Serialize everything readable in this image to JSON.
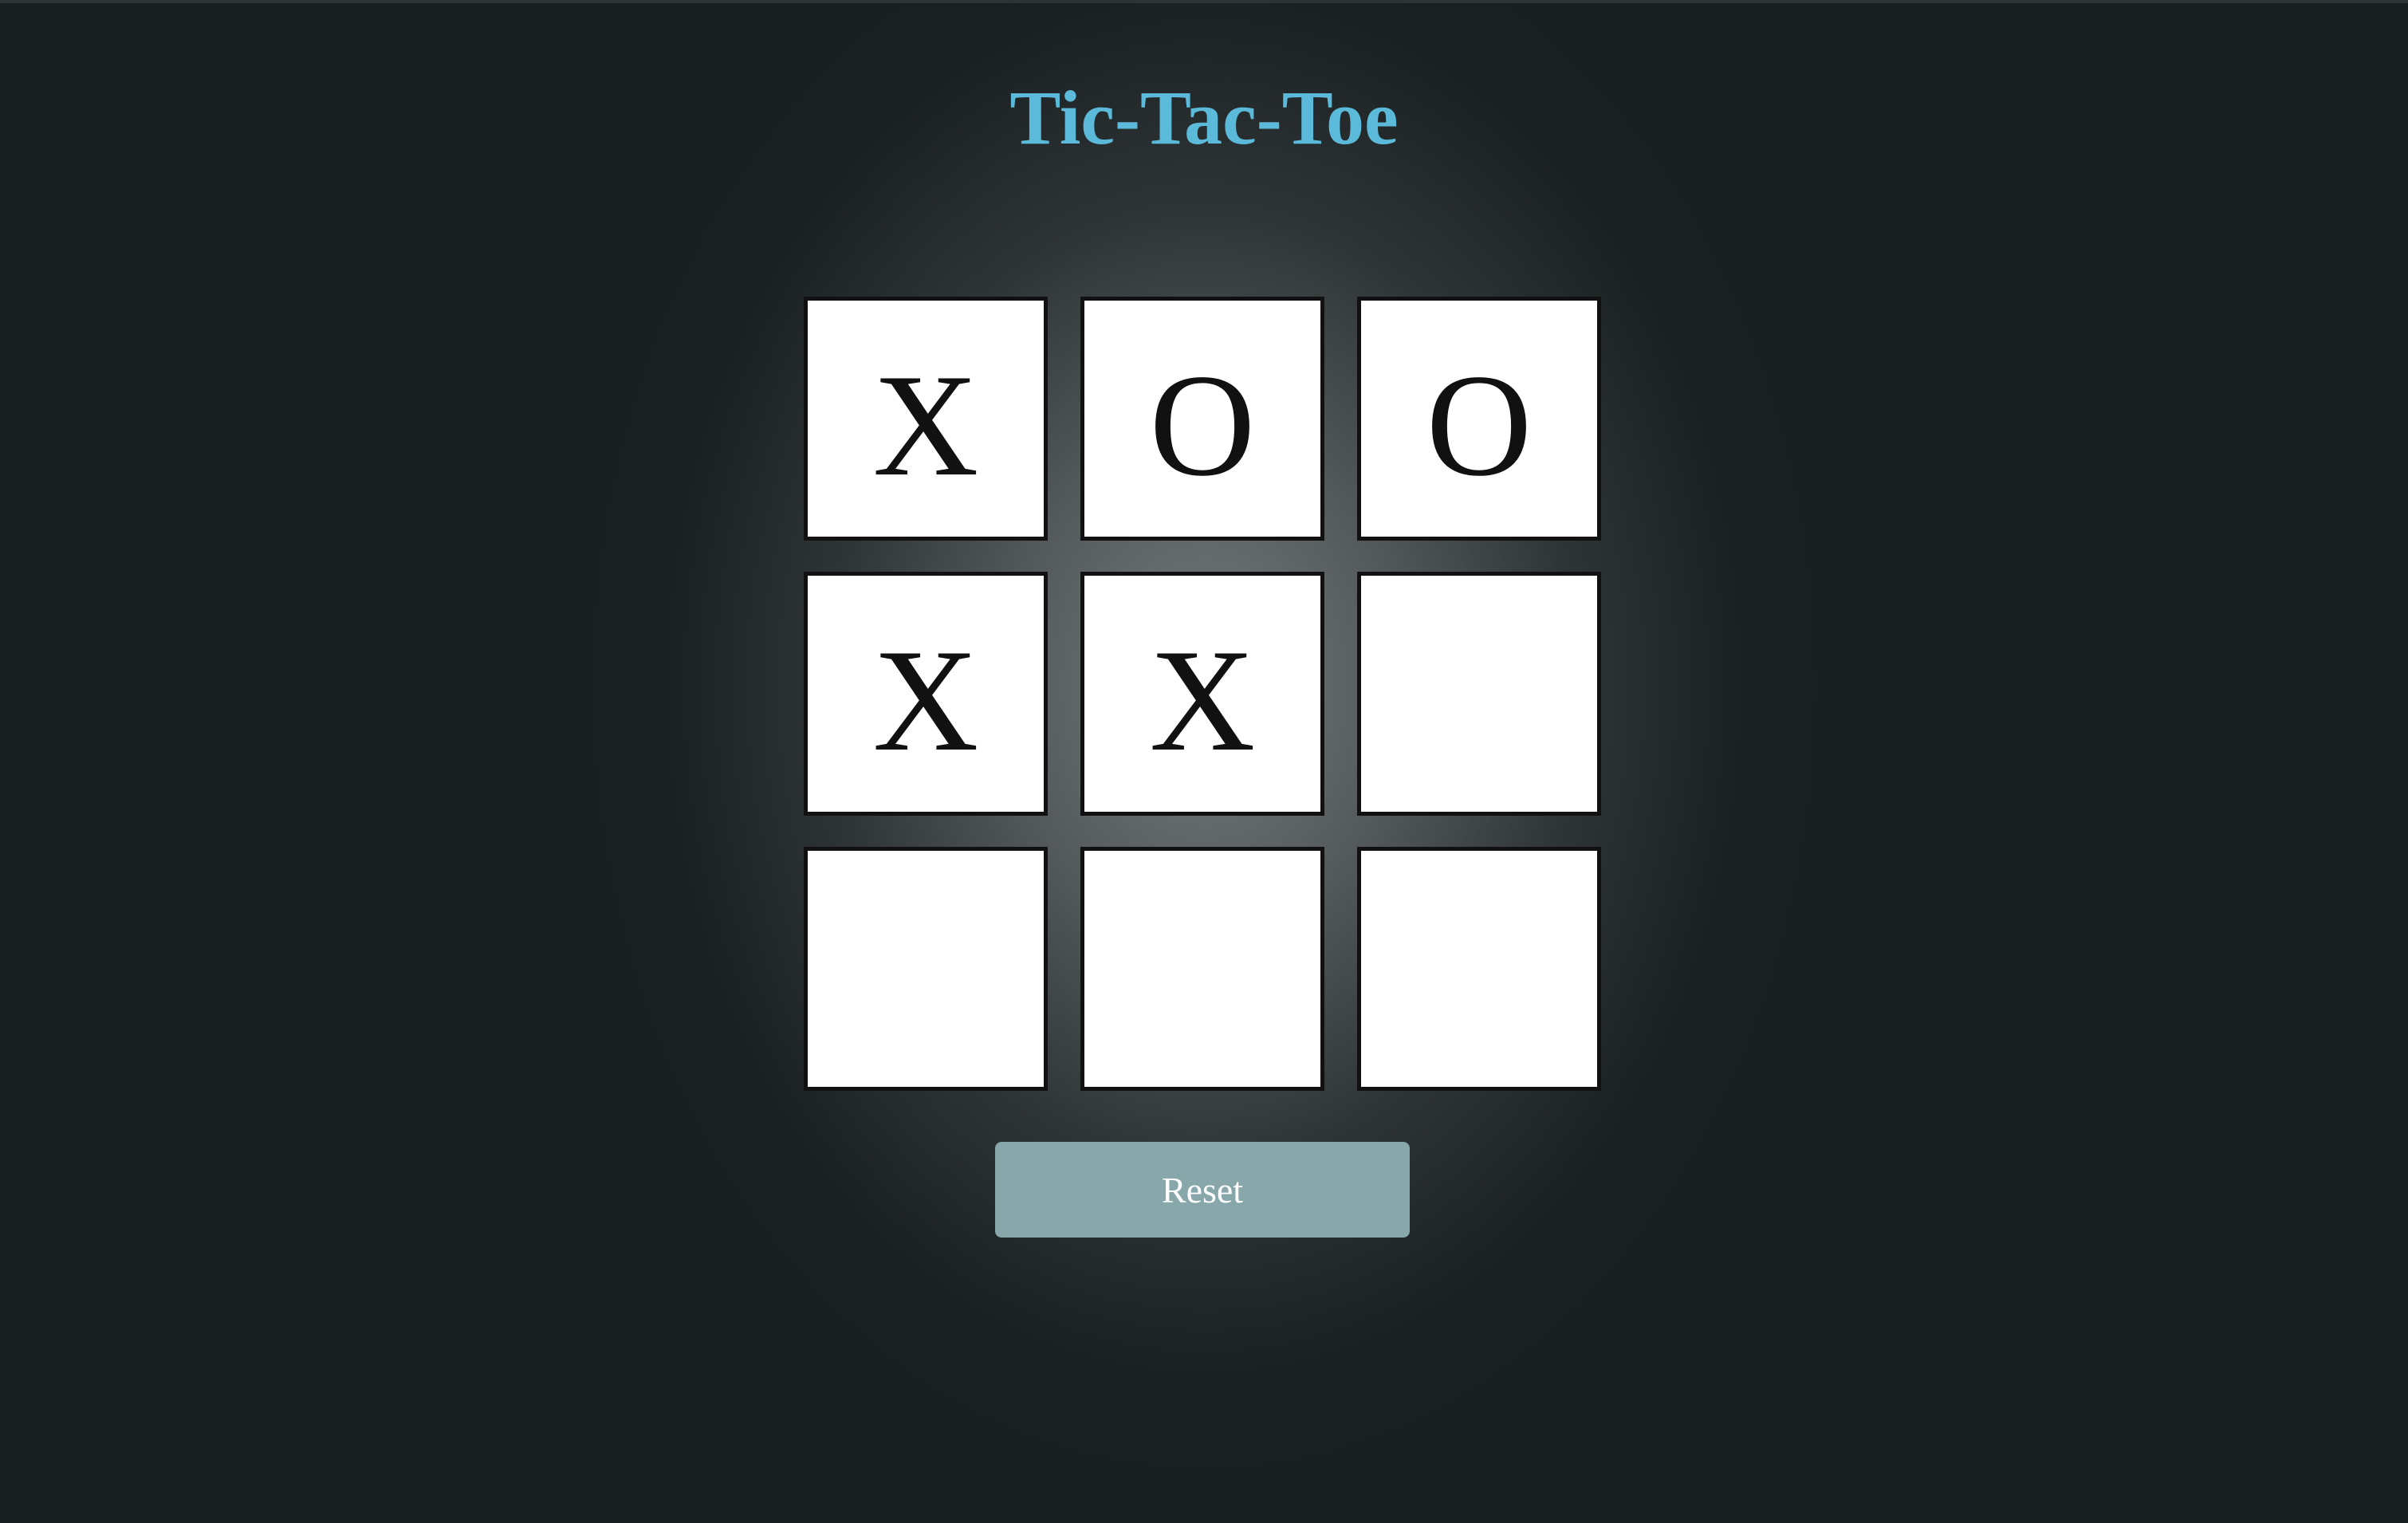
{
  "title": "Tic-Tac-Toe",
  "colors": {
    "title": "#5bbad9",
    "background": "#181e1f",
    "cell": "#ffffff",
    "reset_button": "#88a7aa"
  },
  "board": {
    "cells": [
      {
        "value": "X"
      },
      {
        "value": "O"
      },
      {
        "value": "O"
      },
      {
        "value": "X"
      },
      {
        "value": "X"
      },
      {
        "value": ""
      },
      {
        "value": ""
      },
      {
        "value": ""
      },
      {
        "value": ""
      }
    ]
  },
  "reset_label": "Reset"
}
